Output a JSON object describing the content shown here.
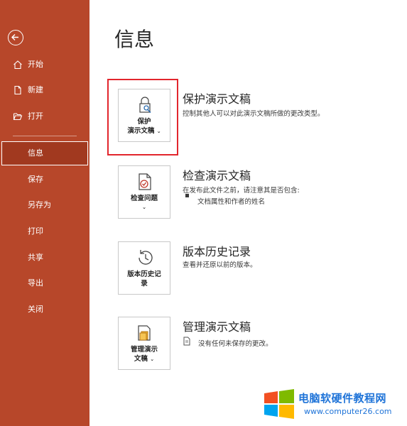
{
  "sidebar": {
    "items": [
      {
        "label": "开始",
        "icon": "home-icon"
      },
      {
        "label": "新建",
        "icon": "new-document-icon"
      },
      {
        "label": "打开",
        "icon": "folder-open-icon"
      },
      {
        "label": "信息",
        "active": true
      },
      {
        "label": "保存"
      },
      {
        "label": "另存为"
      },
      {
        "label": "打印"
      },
      {
        "label": "共享"
      },
      {
        "label": "导出"
      },
      {
        "label": "关闭"
      }
    ]
  },
  "main": {
    "title": "信息",
    "sections": [
      {
        "tile_line1": "保护",
        "tile_line2": "演示文稿",
        "caret": "⌄",
        "title": "保护演示文稿",
        "desc": "控制其他人可以对此演示文稿所做的更改类型。",
        "icon": "lock-icon"
      },
      {
        "tile_line1": "检查问题",
        "caret": "⌄",
        "title": "检查演示文稿",
        "desc": "在发布此文件之前，请注意其是否包含:",
        "bullet": "文档属性和作者的姓名",
        "icon": "inspect-document-icon"
      },
      {
        "tile_line1": "版本历史记",
        "tile_line2": "录",
        "title": "版本历史记录",
        "desc": "查看并还原以前的版本。",
        "icon": "history-icon"
      },
      {
        "tile_line1": "管理演示",
        "tile_line2": "文稿",
        "caret": "⌄",
        "title": "管理演示文稿",
        "desc": "没有任何未保存的更改。",
        "icon": "manage-document-icon"
      }
    ]
  },
  "watermark": {
    "title": "电脑软硬件教程网",
    "url": "www.computer26.com"
  },
  "colors": {
    "sidebar": "#b7472a",
    "sidebar_active": "#a1391f",
    "highlight": "#e2262d",
    "watermark_text": "#1e73d8"
  }
}
